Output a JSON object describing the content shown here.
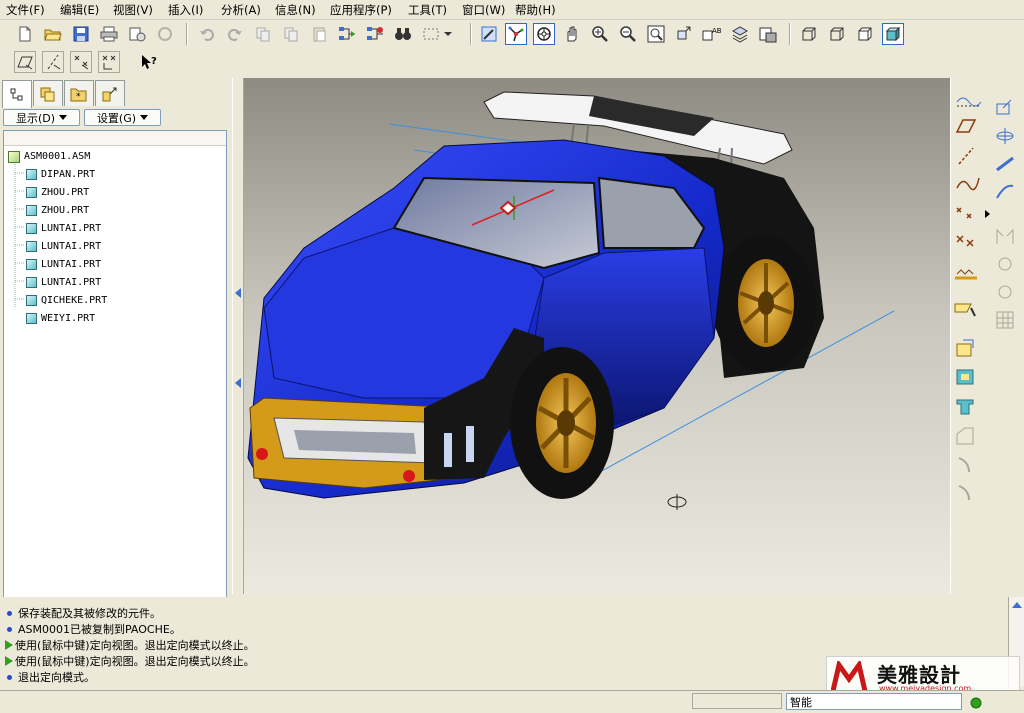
{
  "menu": [
    "文件(F)",
    "编辑(E)",
    "视图(V)",
    "插入(I)",
    "分析(A)",
    "信息(N)",
    "应用程序(P)",
    "工具(T)",
    "窗口(W)",
    "帮助(H)"
  ],
  "left_panel": {
    "display_button": "显示(D)",
    "settings_button": "设置(G)",
    "tree": {
      "root": "ASM0001.ASM",
      "children": [
        "DIPAN.PRT",
        "ZHOU.PRT",
        "ZHOU.PRT",
        "LUNTAI.PRT",
        "LUNTAI.PRT",
        "LUNTAI.PRT",
        "LUNTAI.PRT",
        "QICHEKE.PRT",
        "WEIYI.PRT"
      ]
    }
  },
  "messages": [
    {
      "type": "info",
      "text": "保存装配及其被修改的元件。"
    },
    {
      "type": "info",
      "text": "ASM0001已被复制到PAOCHE。"
    },
    {
      "type": "prompt",
      "text": "使用(鼠标中键)定向视图。退出定向模式以终止。"
    },
    {
      "type": "prompt",
      "text": "使用(鼠标中键)定向视图。退出定向模式以终止。"
    },
    {
      "type": "info",
      "text": "退出定向模式。"
    }
  ],
  "status": {
    "filter_value": "智能"
  },
  "watermark": {
    "brand": "美雅設計",
    "url": "www.meiyadesign.com"
  },
  "colors": {
    "car_body": "#1428c8",
    "wheel_rim": "#d49a1a",
    "selection_blue": "#316ac5",
    "prompt_green": "#2fa01e",
    "info_blue": "#1c4ed0"
  }
}
